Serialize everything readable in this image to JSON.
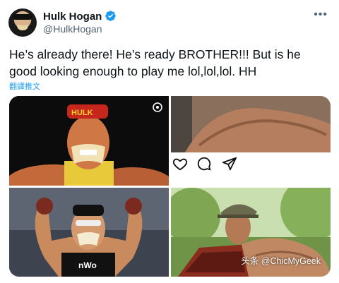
{
  "author": {
    "name": "Hulk Hogan",
    "handle": "@HulkHogan"
  },
  "tweet": {
    "text_line1": "He’s already there!  He’s ready BROTHER!!!  But is he",
    "text_line2": "good looking enough to play me lol,lol,lol. HH",
    "translate_label": "翻譯推文"
  },
  "media": {
    "images": [
      {
        "subject": "Hulk Hogan flexing, red bandana"
      },
      {
        "subject": "close-up of a flexed arm, Instagram post"
      },
      {
        "subject": "Hulk Hogan in nWo outfit flexing"
      },
      {
        "subject": "man in cap flexing outdoors"
      }
    ],
    "bandana_text": "HULK",
    "shirt_text": "nWo"
  },
  "icons": [
    "verified-badge-icon",
    "more-icon",
    "heart-icon",
    "comment-icon",
    "share-icon",
    "expand-icon"
  ],
  "watermark": "头条 @ChicMyGeek",
  "colors": {
    "verified": "#1d9bf0",
    "link": "#1d9bf0",
    "muted": "#536471"
  }
}
